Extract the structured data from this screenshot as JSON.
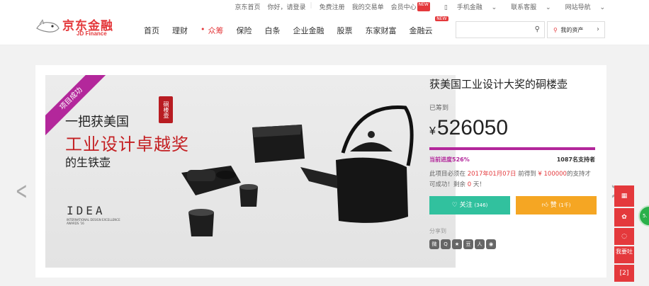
{
  "topbar": {
    "links": [
      "京东首页",
      "你好，请登录",
      "免费注册",
      "我的交易单",
      "会员中心",
      "手机金融",
      "联系客服",
      "网站导航"
    ],
    "new_tag": "NEW"
  },
  "logo": {
    "cn": "京东金融",
    "en": "JD Finance"
  },
  "nav": {
    "items": [
      "首页",
      "理财",
      "众筹",
      "保险",
      "白条",
      "企业金融",
      "股票",
      "东家财富",
      "金融云"
    ],
    "cloud_badge": "NEW"
  },
  "search": {
    "placeholder": ""
  },
  "asset": {
    "label": "我的资产"
  },
  "hero": {
    "ribbon": "项目成功",
    "slogan_line1": "一把获美国",
    "slogan_line2": "工业设计卓越奖",
    "slogan_line3": "的生铁壶",
    "seal": "硐楼壶",
    "idea_logo": "IDEA",
    "idea_caption": "INTERNATIONAL DESIGN EXCELLENCE AWARDS '16"
  },
  "project": {
    "title": "获美国工业设计大奖的硐楼壶",
    "raised_label": "已筹到",
    "currency": "¥",
    "amount": "526050",
    "progress_fraction": 1.0,
    "progress_label": "当前进度526%",
    "supporters": "1087名支持者",
    "note_prefix": "此项目必须在",
    "note_date": "2017年01月07日",
    "note_mid": "前得到",
    "note_goal": "¥ 100000",
    "note_suffix": "的支持才可成功！剩余",
    "note_days": "0",
    "note_end": "天！",
    "follow_label": "关注",
    "follow_count": "(346)",
    "like_label": "赞",
    "like_count": "(1千)",
    "share_label": "分享到"
  },
  "side": {
    "feedback": "我要吐",
    "top": "[2]"
  },
  "colors": {
    "brand": "#e4393c",
    "progress": "#b3279b",
    "follow": "#31c19e",
    "like": "#f5a623"
  }
}
